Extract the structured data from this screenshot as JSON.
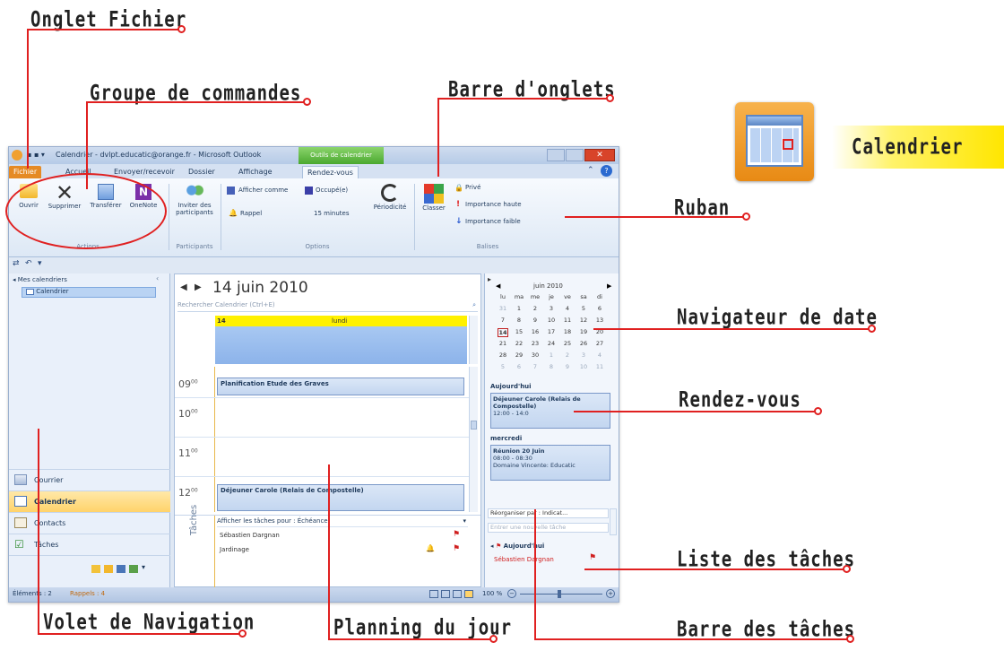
{
  "callouts": {
    "onglet_fichier": "Onglet Fichier",
    "groupe_commandes": "Groupe de commandes",
    "barre_onglets": "Barre d'onglets",
    "calendrier": "Calendrier",
    "ruban": "Ruban",
    "navigateur_date": "Navigateur de date",
    "rendez_vous": "Rendez-vous",
    "liste_taches": "Liste des tâches",
    "volet_navigation": "Volet de Navigation",
    "planning_jour": "Planning du jour",
    "barre_taches": "Barre des tâches"
  },
  "window": {
    "title": "Calendrier - dvlpt.educatic@orange.fr - Microsoft Outlook",
    "context_tab": "Outils de calendrier",
    "tabs": {
      "fichier": "Fichier",
      "accueil": "Accueil",
      "envoyer": "Envoyer/recevoir",
      "dossier": "Dossier",
      "affichage": "Affichage",
      "rendezvous": "Rendez-vous"
    }
  },
  "ribbon": {
    "actions": {
      "ouvrir": "Ouvrir",
      "supprimer": "Supprimer",
      "transferer": "Transférer",
      "onenote": "OneNote",
      "group": "Actions"
    },
    "participants": {
      "inviter": "Inviter des participants",
      "group": "Participants"
    },
    "options": {
      "afficher_comme": "Afficher comme",
      "occupe": "Occupé(e)",
      "rappel": "Rappel",
      "minutes": "15 minutes",
      "periodicite": "Périodicité",
      "group": "Options"
    },
    "balises": {
      "classer": "Classer",
      "prive": "Privé",
      "importance_haute": "Importance haute",
      "importance_faible": "Importance faible",
      "group": "Balises"
    }
  },
  "nav_pane": {
    "header": "Mes calendriers",
    "calendar_item": "Calendrier",
    "buttons": {
      "courrier": "Courrier",
      "calendrier": "Calendrier",
      "contacts": "Contacts",
      "taches": "Tâches"
    }
  },
  "calendar": {
    "date": "14 juin 2010",
    "search_placeholder": "Rechercher Calendrier (Ctrl+E)",
    "day_number": "14",
    "day_name": "lundi",
    "hours": {
      "h9": "09",
      "h10": "10",
      "h11": "11",
      "h12": "12",
      "minutes": "00"
    },
    "appointments": {
      "a1": "Planification Etude des Graves",
      "a2": "Déjeuner Carole (Relais de Compostelle)"
    },
    "tasks": {
      "side_label": "Tâches",
      "header": "Afficher les tâches pour : Échéance",
      "t1": "Sébastien Dargnan",
      "t2": "Jardinage"
    }
  },
  "todo_bar": {
    "mini_title": "juin 2010",
    "weekdays": [
      "lu",
      "ma",
      "me",
      "je",
      "ve",
      "sa",
      "di"
    ],
    "weeks": [
      [
        "31",
        "1",
        "2",
        "3",
        "4",
        "5",
        "6"
      ],
      [
        "7",
        "8",
        "9",
        "10",
        "11",
        "12",
        "13"
      ],
      [
        "14",
        "15",
        "16",
        "17",
        "18",
        "19",
        "20"
      ],
      [
        "21",
        "22",
        "23",
        "24",
        "25",
        "26",
        "27"
      ],
      [
        "28",
        "29",
        "30",
        "1",
        "2",
        "3",
        "4"
      ],
      [
        "5",
        "6",
        "7",
        "8",
        "9",
        "10",
        "11"
      ]
    ],
    "today_label": "Aujourd'hui",
    "appt1_title": "Déjeuner Carole (Relais de Compostelle)",
    "appt1_time": "12:00 - 14:0",
    "tomorrow_label": "mercredi",
    "appt2_title": "Réunion 20 Juin",
    "appt2_time": "08:00 - 08:30",
    "appt2_place": "Domaine Vincente: Educatic",
    "arrange": "Réorganiser par : Indicat...",
    "new_task": "Entrer une nouvelle tâche",
    "today_group": "Aujourd'hui",
    "task_item": "Sébastien Dargnan"
  },
  "status": {
    "elements": "Éléments : 2",
    "rappels": "Rappels : 4",
    "zoom": "100 %"
  },
  "colors": {
    "callout_line": "#e02020",
    "highlight": "#ffe600",
    "file_tab": "#e58a24",
    "context_tab": "#4aa82f",
    "day_header": "#fff100"
  }
}
